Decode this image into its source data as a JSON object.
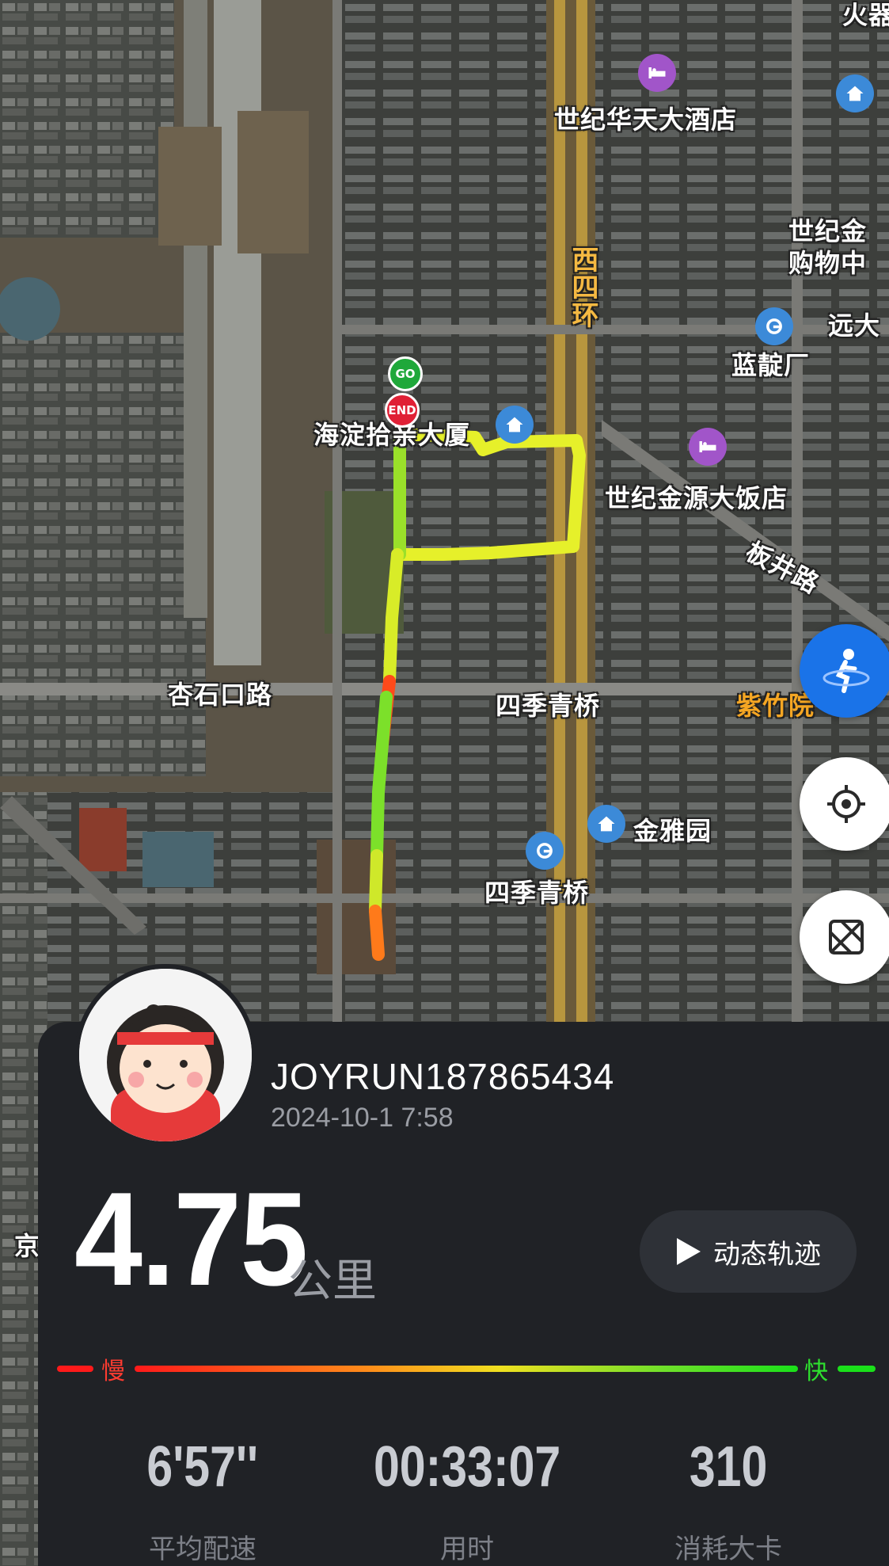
{
  "map": {
    "labels": {
      "hotel1": "世纪华天大酒店",
      "mall": "世纪金源购物中心",
      "mall_line1": "世纪金",
      "mall_line2": "购物中",
      "yuan": "远大",
      "landianchang": "蓝靛厂",
      "haidian": "海淀拾亲大厦",
      "hotel2": "世纪金源大饭店",
      "banjing": "板井路",
      "xingshikou": "杏石口路",
      "sijiqingqiao_bridge": "四季青桥",
      "zizhu": "紫竹院",
      "jinyayuan": "金雅园",
      "sijiqingqiao_station": "四季青桥",
      "huoqi": "火器",
      "jing": "京",
      "xisihuan": "西四环"
    },
    "start_marker": "GO",
    "end_marker": "END"
  },
  "profile": {
    "username": "JOYRUN187865434",
    "datetime": "2024-10-1 7:58"
  },
  "summary": {
    "distance": "4.75",
    "unit": "公里",
    "replay_label": "动态轨迹"
  },
  "speed_legend": {
    "slow": "慢",
    "fast": "快"
  },
  "stats": [
    {
      "value": "6'57''",
      "label": "平均配速"
    },
    {
      "value": "00:33:07",
      "label": "用时"
    },
    {
      "value": "310",
      "label": "消耗大卡"
    }
  ],
  "colors": {
    "panel": "#202226",
    "route_slow": "#ff2a1a",
    "route_mid": "#f0f020",
    "route_fast": "#2ee02e",
    "fab_blue": "#1a73e8"
  }
}
